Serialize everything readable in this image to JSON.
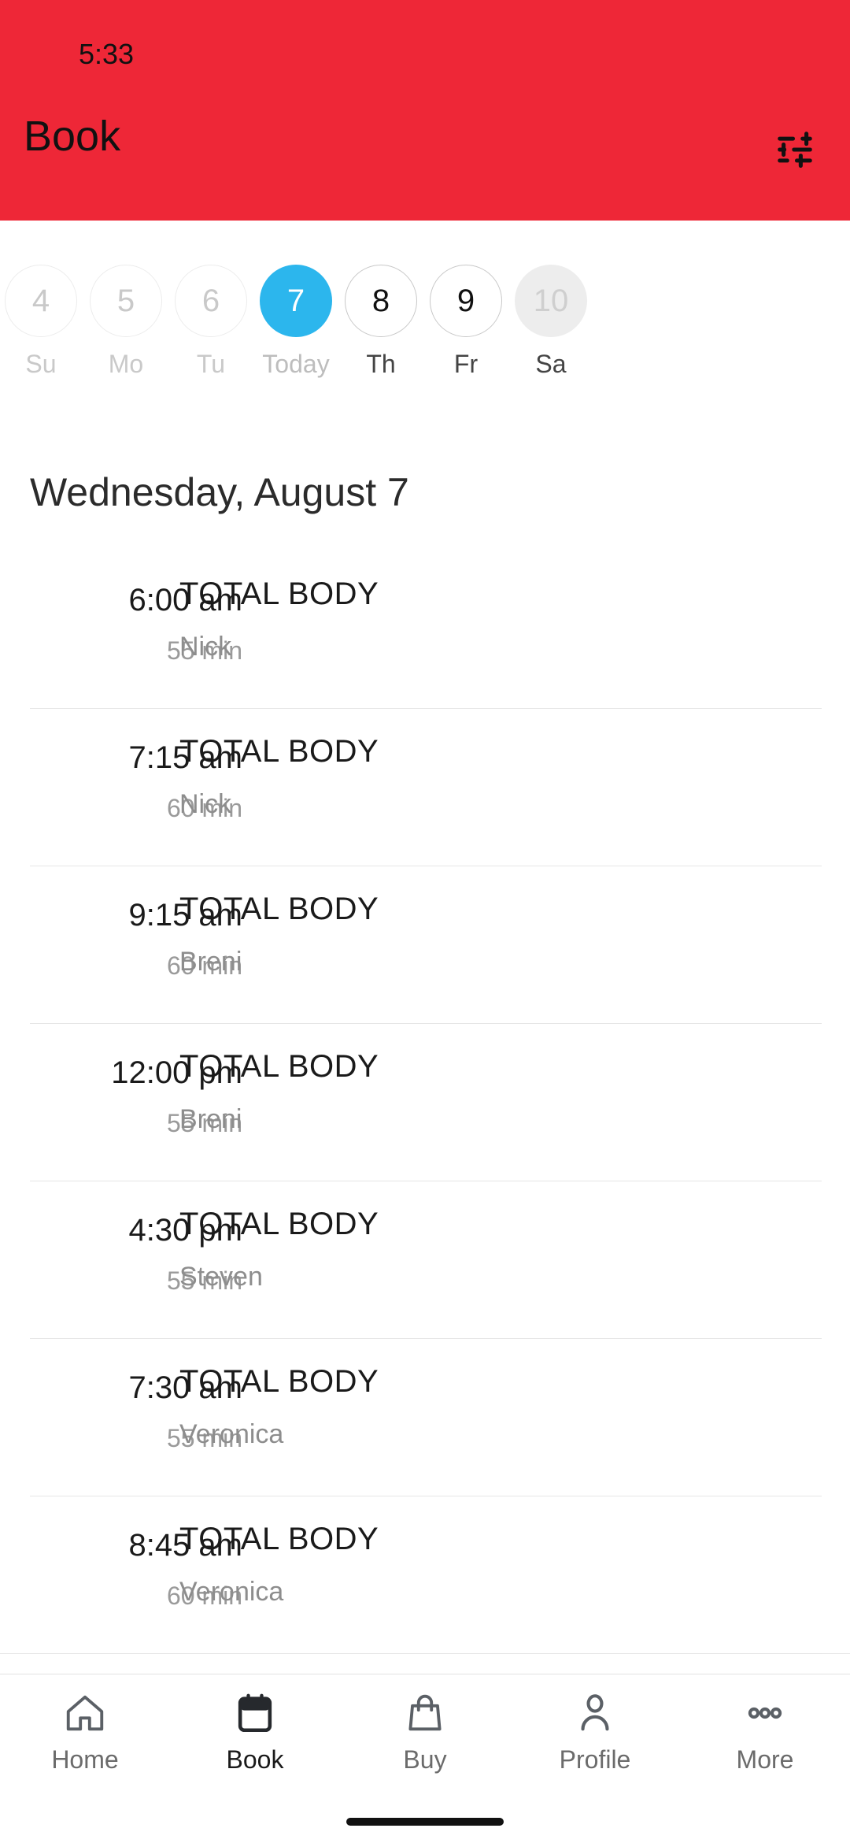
{
  "status": {
    "time": "5:33"
  },
  "appbar": {
    "title": "Book",
    "filter_icon": "tune-filter-icon",
    "background_color": "#EE2737"
  },
  "date_strip": {
    "selected_color": "#2CB6ED",
    "items": [
      {
        "day_number": "4",
        "day_label": "Su",
        "state": "past"
      },
      {
        "day_number": "5",
        "day_label": "Mo",
        "state": "past"
      },
      {
        "day_number": "6",
        "day_label": "Tu",
        "state": "past"
      },
      {
        "day_number": "7",
        "day_label": "Today",
        "state": "selected"
      },
      {
        "day_number": "8",
        "day_label": "Th",
        "state": "normal"
      },
      {
        "day_number": "9",
        "day_label": "Fr",
        "state": "normal"
      },
      {
        "day_number": "10",
        "day_label": "Sa",
        "state": "filled"
      }
    ]
  },
  "day_title": "Wednesday, August 7",
  "classes": [
    {
      "time": "6:00 am",
      "duration": "55 min",
      "name": "TOTAL BODY",
      "instructor": "Nick"
    },
    {
      "time": "7:15 am",
      "duration": "60 min",
      "name": "TOTAL BODY",
      "instructor": "Nick"
    },
    {
      "time": "9:15 am",
      "duration": "60 min",
      "name": "TOTAL BODY",
      "instructor": "Breni"
    },
    {
      "time": "12:00 pm",
      "duration": "55 min",
      "name": "TOTAL BODY",
      "instructor": "Breni"
    },
    {
      "time": "4:30 pm",
      "duration": "55 min",
      "name": "TOTAL BODY",
      "instructor": "Steven"
    },
    {
      "time": "7:30 am",
      "duration": "55 min",
      "name": "TOTAL BODY",
      "instructor": "Veronica"
    },
    {
      "time": "8:45 am",
      "duration": "60 min",
      "name": "TOTAL BODY",
      "instructor": "Veronica"
    }
  ],
  "bottom_nav": {
    "items": [
      {
        "label": "Home",
        "icon": "home-icon",
        "active": false
      },
      {
        "label": "Book",
        "icon": "calendar-icon",
        "active": true
      },
      {
        "label": "Buy",
        "icon": "bag-icon",
        "active": false
      },
      {
        "label": "Profile",
        "icon": "person-icon",
        "active": false
      },
      {
        "label": "More",
        "icon": "dots-icon",
        "active": false
      }
    ]
  }
}
